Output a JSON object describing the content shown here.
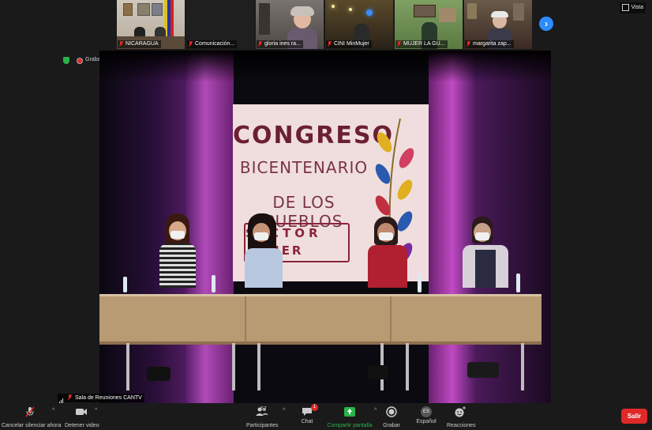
{
  "participants_strip": [
    {
      "name": "NICARAGUA"
    },
    {
      "name": "Comunicación..."
    },
    {
      "name": "gloria ines ra..."
    },
    {
      "name": "CINI MinMujer"
    },
    {
      "name": "MUJER LA GU..."
    },
    {
      "name": "margarita zap..."
    }
  ],
  "view_label": "Vista",
  "recording_label": "Grabando",
  "active_speaker": "Sala de Reuniones CANTV",
  "banner": {
    "line1": "CONGRESO",
    "line2": "BICENTENARIO",
    "line3": "DE LOS PUEBLOS",
    "line4": "SECTOR",
    "line5": "MUJER"
  },
  "toolbar": {
    "unmute_label": "Cancelar silenciar ahora",
    "stop_video_label": "Detener video",
    "participants_label": "Participantes",
    "participants_count": "67",
    "chat_label": "Chat",
    "chat_badge": "1",
    "share_label": "Compartir pantalla",
    "record_label": "Grabar",
    "language_label": "Español",
    "language_code": "ES",
    "reactions_label": "Reacciones",
    "leave_label": "Salir"
  },
  "colors": {
    "accent": "#2d8cff",
    "share_green": "#2bb24c",
    "leave_red": "#e02828"
  }
}
